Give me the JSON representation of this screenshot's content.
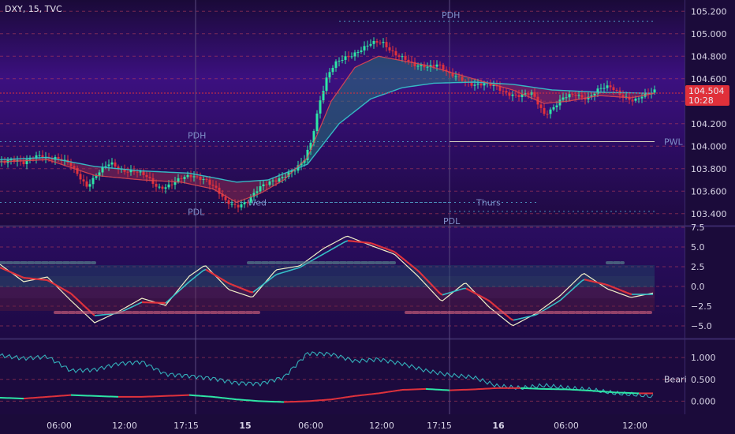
{
  "header": {
    "symbol": "DXY",
    "interval": "15",
    "source": "TVC",
    "separator": ", "
  },
  "colors": {
    "background_top": "#1b0b3a",
    "background_mid": "#3a0f7a",
    "bull": "#2ee6a6",
    "bear": "#e0323c",
    "ema": "#36c1c8",
    "signal": "#f2f0c8",
    "price_badge": "#e0303a",
    "axis_text": "#d8d4e6",
    "level_text": "#7f8fc8"
  },
  "price_badge": {
    "price": "104.504",
    "countdown": "10:28"
  },
  "chart_data": [
    {
      "type": "candlestick",
      "name": "price",
      "ylim": [
        103.3,
        105.3
      ],
      "y_ticks": [
        "105.200",
        "105.000",
        "104.800",
        "104.600",
        "104.400",
        "104.200",
        "104.000",
        "103.800",
        "103.600",
        "103.400"
      ],
      "x_ticks": [
        "06:00",
        "12:00",
        "17:15",
        "15",
        "06:00",
        "12:00",
        "17:15",
        "16",
        "06:00",
        "12:00"
      ],
      "close_path": [
        [
          0,
          103.86
        ],
        [
          15,
          103.9
        ],
        [
          30,
          103.84
        ],
        [
          50,
          103.92
        ],
        [
          70,
          103.9
        ],
        [
          90,
          103.82
        ],
        [
          110,
          103.66
        ],
        [
          125,
          103.76
        ],
        [
          140,
          103.84
        ],
        [
          155,
          103.8
        ],
        [
          170,
          103.78
        ],
        [
          185,
          103.72
        ],
        [
          200,
          103.64
        ],
        [
          215,
          103.66
        ],
        [
          230,
          103.7
        ],
        [
          245,
          103.74
        ],
        [
          260,
          103.72
        ],
        [
          275,
          103.6
        ],
        [
          285,
          103.5
        ],
        [
          300,
          103.48
        ],
        [
          315,
          103.52
        ],
        [
          330,
          103.62
        ],
        [
          345,
          103.7
        ],
        [
          360,
          103.74
        ],
        [
          375,
          103.78
        ],
        [
          385,
          103.86
        ],
        [
          395,
          104.06
        ],
        [
          405,
          104.4
        ],
        [
          415,
          104.62
        ],
        [
          425,
          104.72
        ],
        [
          440,
          104.8
        ],
        [
          455,
          104.86
        ],
        [
          470,
          104.9
        ],
        [
          485,
          104.92
        ],
        [
          500,
          104.84
        ],
        [
          512,
          104.78
        ],
        [
          525,
          104.7
        ],
        [
          540,
          104.72
        ],
        [
          555,
          104.74
        ],
        [
          570,
          104.62
        ],
        [
          585,
          104.6
        ],
        [
          600,
          104.56
        ],
        [
          615,
          104.54
        ],
        [
          630,
          104.52
        ],
        [
          645,
          104.48
        ],
        [
          660,
          104.44
        ],
        [
          675,
          104.46
        ],
        [
          690,
          104.3
        ],
        [
          700,
          104.34
        ],
        [
          715,
          104.42
        ],
        [
          730,
          104.46
        ],
        [
          745,
          104.44
        ],
        [
          760,
          104.5
        ],
        [
          775,
          104.52
        ],
        [
          790,
          104.46
        ],
        [
          805,
          104.4
        ],
        [
          818,
          104.44
        ],
        [
          830,
          104.5
        ]
      ],
      "series": [
        {
          "name": "",
          "points": [
            [
              0,
              103.88
            ],
            [
              60,
              103.9
            ],
            [
              120,
              103.82
            ],
            [
              180,
              103.78
            ],
            [
              240,
              103.76
            ],
            [
              300,
              103.68
            ],
            [
              340,
              103.7
            ],
            [
              390,
              103.84
            ],
            [
              430,
              104.2
            ],
            [
              470,
              104.42
            ],
            [
              510,
              104.52
            ],
            [
              550,
              104.56
            ],
            [
              600,
              104.57
            ],
            [
              650,
              104.55
            ],
            [
              700,
              104.5
            ],
            [
              760,
              104.48
            ],
            [
              830,
              104.47
            ]
          ]
        },
        {
          "name": "",
          "points": [
            [
              0,
              103.86
            ],
            [
              60,
              103.88
            ],
            [
              120,
              103.74
            ],
            [
              180,
              103.7
            ],
            [
              230,
              103.68
            ],
            [
              270,
              103.62
            ],
            [
              300,
              103.5
            ],
            [
              330,
              103.58
            ],
            [
              360,
              103.7
            ],
            [
              390,
              103.9
            ],
            [
              420,
              104.4
            ],
            [
              450,
              104.7
            ],
            [
              480,
              104.8
            ],
            [
              510,
              104.76
            ],
            [
              540,
              104.72
            ],
            [
              570,
              104.66
            ],
            [
              610,
              104.58
            ],
            [
              650,
              104.5
            ],
            [
              690,
              104.38
            ],
            [
              720,
              104.4
            ],
            [
              760,
              104.45
            ],
            [
              800,
              104.43
            ],
            [
              830,
              104.47
            ]
          ]
        }
      ],
      "levels": [
        {
          "label": "PDH",
          "price": 105.11,
          "x_range": [
            430,
            830
          ]
        },
        {
          "label": "PDH",
          "price": 104.04,
          "x_range": [
            0,
            570
          ]
        },
        {
          "label": "PWL",
          "price": 104.04,
          "x_range": [
            570,
            830
          ]
        },
        {
          "label": "PDL",
          "price": 103.5,
          "x_range": [
            0,
            570
          ]
        },
        {
          "label": "PDL",
          "price": 103.42,
          "x_range": [
            570,
            830
          ]
        },
        {
          "label": "Wed",
          "price": 103.5,
          "x_range": [
            280,
            570
          ]
        },
        {
          "label": "Thurs",
          "price": 103.5,
          "x_range": [
            570,
            680
          ]
        }
      ]
    },
    {
      "type": "line",
      "name": "oscillator",
      "ylim": [
        -6.5,
        7.5
      ],
      "y_ticks": [
        "7.5",
        "5.0",
        "2.5",
        "0.0",
        "−2.5",
        "−5.0"
      ],
      "x": [
        0,
        30,
        60,
        90,
        120,
        150,
        180,
        210,
        240,
        260,
        290,
        320,
        350,
        380,
        410,
        440,
        470,
        500,
        530,
        560,
        590,
        620,
        650,
        680,
        710,
        740,
        770,
        800,
        830
      ],
      "series": [
        {
          "name": "",
          "values": [
            2.8,
            0.6,
            1.2,
            -1.8,
            -4.6,
            -3.2,
            -1.5,
            -2.4,
            1.3,
            2.7,
            -0.4,
            -1.4,
            2.1,
            2.6,
            4.8,
            6.4,
            5.2,
            4.1,
            1.3,
            -1.9,
            0.5,
            -2.6,
            -5.0,
            -3.4,
            -1.2,
            1.7,
            -0.3,
            -1.4,
            -0.8
          ]
        },
        {
          "name": "",
          "values": [
            2.4,
            1.1,
            0.8,
            -0.9,
            -3.7,
            -3.4,
            -2.0,
            -2.1,
            0.6,
            2.2,
            0.4,
            -0.8,
            1.5,
            2.4,
            4.1,
            5.8,
            5.5,
            4.4,
            2.0,
            -1.1,
            -0.2,
            -1.8,
            -4.3,
            -3.6,
            -1.8,
            0.9,
            0.2,
            -1.0,
            -1.0
          ]
        }
      ]
    },
    {
      "type": "line",
      "name": "volatility",
      "ylim": [
        -0.3,
        1.4
      ],
      "y_ticks": [
        "1.000",
        "0.500",
        "0.000"
      ],
      "x": [
        0,
        30,
        60,
        90,
        120,
        150,
        180,
        210,
        240,
        270,
        300,
        330,
        360,
        390,
        420,
        450,
        480,
        510,
        540,
        570,
        600,
        630,
        660,
        690,
        720,
        750,
        780,
        810,
        830
      ],
      "series": [
        {
          "name": "",
          "values": [
            1.05,
            0.98,
            1.02,
            0.7,
            0.72,
            0.86,
            0.9,
            0.62,
            0.58,
            0.52,
            0.42,
            0.4,
            0.55,
            1.1,
            1.08,
            0.92,
            0.96,
            0.86,
            0.7,
            0.6,
            0.55,
            0.35,
            0.3,
            0.36,
            0.3,
            0.26,
            0.18,
            0.14,
            0.1
          ]
        },
        {
          "name": "Beari",
          "values": [
            0.08,
            0.06,
            0.1,
            0.14,
            0.12,
            0.1,
            0.1,
            0.12,
            0.14,
            0.1,
            0.04,
            0.0,
            -0.02,
            0.0,
            0.04,
            0.12,
            0.18,
            0.26,
            0.28,
            0.25,
            0.27,
            0.3,
            0.3,
            0.28,
            0.27,
            0.24,
            0.2,
            0.18,
            0.18
          ]
        }
      ]
    }
  ]
}
